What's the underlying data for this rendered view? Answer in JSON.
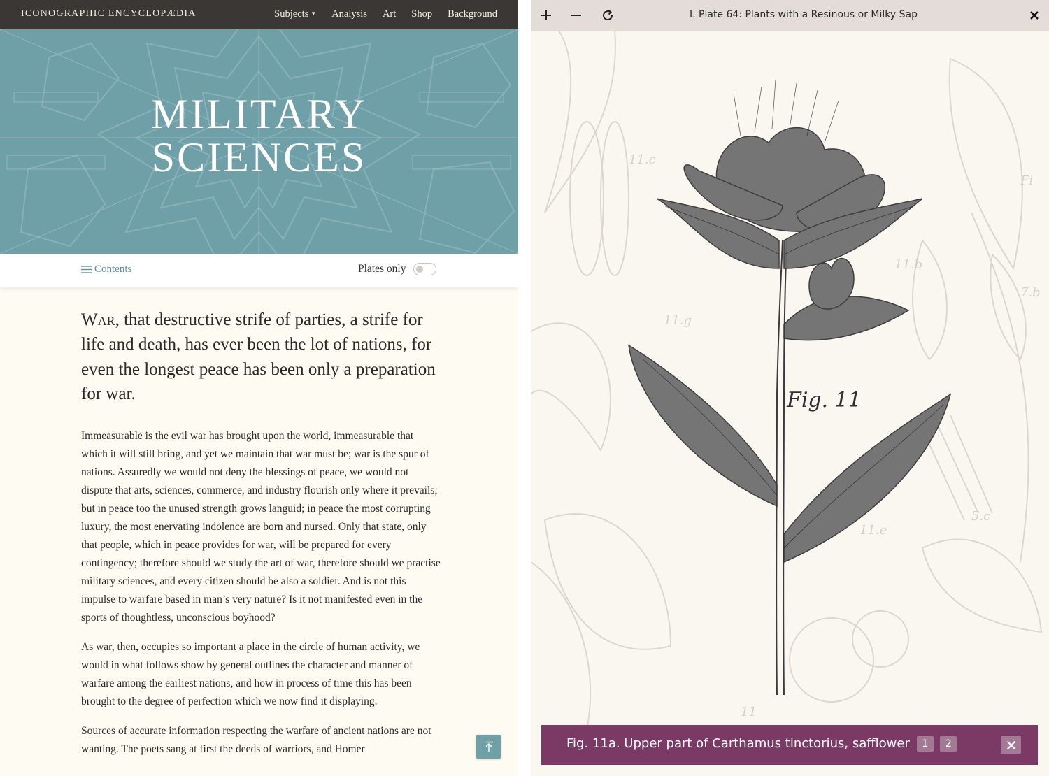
{
  "nav": {
    "brand": "ICONOGRAPHIC ENCYCLOPÆDIA",
    "links": [
      "Subjects",
      "Analysis",
      "Art",
      "Shop",
      "Background"
    ]
  },
  "hero": {
    "title_line1": "MILITARY",
    "title_line2": "SCIENCES"
  },
  "toolbar": {
    "contents_label": "Contents",
    "plates_only_label": "Plates only",
    "plates_only_on": false
  },
  "article": {
    "lead_first_word": "War",
    "lead_rest": ", that destructive strife of parties, a strife for life and death, has ever been the lot of nations, for even the longest peace has been only a preparation for war.",
    "paragraphs": [
      "Immeasurable is the evil war has brought upon the world, immeasurable that which it will still bring, and yet we maintain that war must be; war is the spur of nations. Assuredly we would not deny the blessings of peace, we would not dispute that arts, sciences, commerce, and industry flourish only where it prevails; but in peace too the unused strength grows languid; in peace the most corrupting luxury, the most enervating indolence are born and nursed. Only that state, only that people, which in peace provides for war, will be prepared for every contingency; therefore should we study the art of war, therefore should we practise military sciences, and every citizen should be also a soldier. And is not this impulse to warfare based in man’s very nature? Is it not manifested even in the sports of thoughtless, unconscious boyhood?",
      "As war, then, occupies so important a place in the circle of human activity, we would in what follows show by general outlines the character and manner of warfare among the earliest nations, and how in process of time this has been brought to the degree of perfection which we now find it displaying.",
      "Sources of accurate information respecting the warfare of ancient nations are not wanting. The poets sang at first the deeds of warriors, and Homer"
    ]
  },
  "viewer": {
    "title": "I. Plate 64: Plants with a Resinous or Milky Sap",
    "plate_label": "Fig. 11",
    "caption": "Fig. 11a. Upper part of Carthamus tinctorius, safflower",
    "pages": [
      "1",
      "2"
    ],
    "accent_color": "#7b3a65",
    "icons": [
      "plus-icon",
      "minus-icon",
      "reload-icon",
      "close-icon",
      "back-to-top-icon",
      "hamburger-icon"
    ]
  }
}
